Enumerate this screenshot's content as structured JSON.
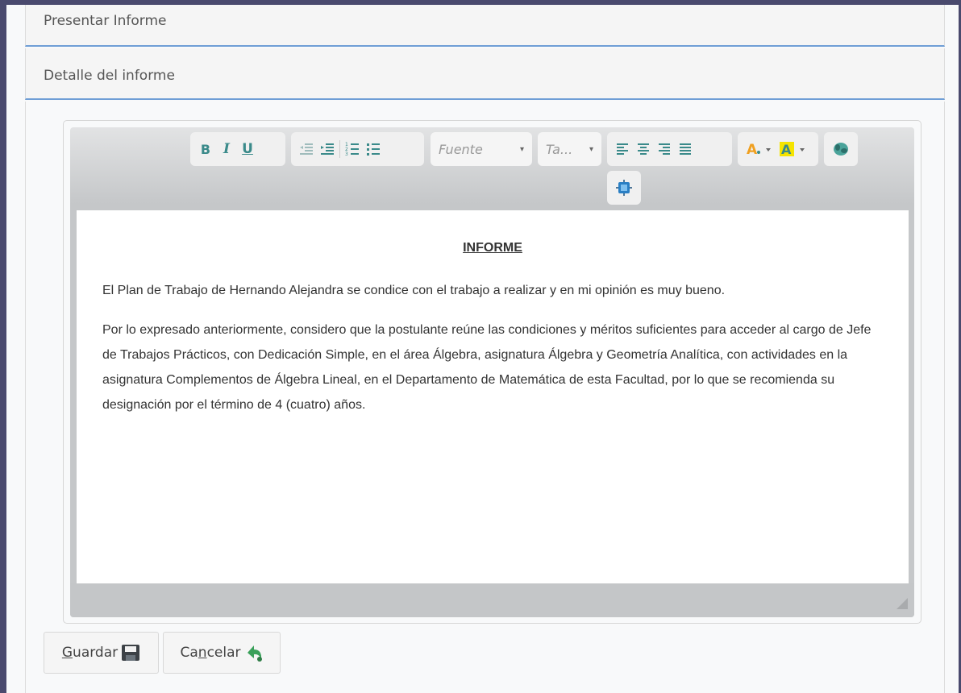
{
  "panels": {
    "present_title": "Presentar Informe",
    "detail_title": "Detalle del informe"
  },
  "toolbar": {
    "bold": "B",
    "italic": "I",
    "underline": "U",
    "font_placeholder": "Fuente",
    "size_placeholder": "Ta...",
    "dropdown_arrow": "▾"
  },
  "document": {
    "heading": "INFORME",
    "paragraph1": "El Plan de Trabajo de Hernando Alejandra se condice con el trabajo a realizar y en mi opinión es muy bueno.",
    "paragraph2": "Por lo expresado anteriormente, considero que la postulante reúne las condiciones y méritos suficientes para acceder al cargo de Jefe de Trabajos Prácticos, con Dedicación Simple, en el área Álgebra, asignatura Álgebra y Geometría Analítica, con actividades en la asignatura Complementos de Álgebra Lineal, en el Departamento de Matemática de esta Facultad, por lo que se recomienda su designación por el término de 4 (cuatro) años."
  },
  "actions": {
    "save_pre": "",
    "save_access": "G",
    "save_post": "uardar",
    "cancel_pre": "Ca",
    "cancel_access": "n",
    "cancel_post": "celar"
  },
  "colors": {
    "accent_line": "#6f9ed6",
    "toolbar_icon": "#3a8a8a",
    "font_color_icon": "#f0a020",
    "highlight_icon": "#f5e400"
  },
  "icons": {
    "save": "floppy-disk-icon",
    "cancel": "back-arrow-icon",
    "source": "html-source-icon",
    "maximize": "maximize-icon"
  }
}
